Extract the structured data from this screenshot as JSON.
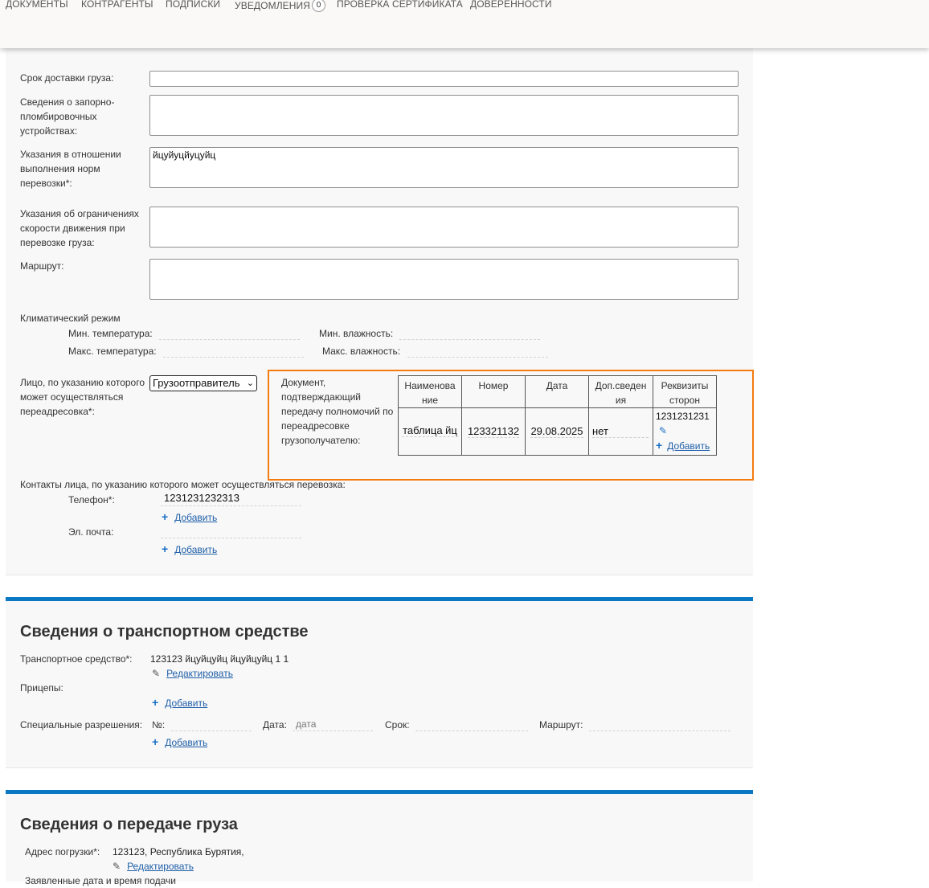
{
  "nav": {
    "items": [
      "ДОКУМЕНТЫ",
      "КОНТРАГЕНТЫ",
      "ПОДПИСКИ",
      "УВЕДОМЛЕНИЯ",
      "ПРОВЕРКА СЕРТИФИКАТА",
      "ДОВЕРЕННОСТИ"
    ],
    "notifications_count": "0"
  },
  "form": {
    "delivery_term_label": "Срок доставки груза:",
    "seal_devices_label": "Сведения о запорно-пломбировочных устройствах:",
    "norms_label": "Указания в отношении выполнения норм перевозки*:",
    "norms_value": "йцуйуцйуцуйц",
    "speed_limits_label": "Указания об ограничениях скорости движения при перевозке груза:",
    "route_label": "Маршрут:",
    "climate": {
      "title": "Климатический режим",
      "min_temp_label": "Мин. температура:",
      "max_temp_label": "Макс. температура:",
      "min_humidity_label": "Мин. влажность:",
      "max_humidity_label": "Макс. влажность:"
    },
    "redirect_person_label": "Лицо, по указанию которого может осуществляться переадресовка*:",
    "redirect_person_value": "Грузоотправитель",
    "authority_doc_label": "Документ, подтверждающий передачу полномочий по переадресовке грузополучателю:",
    "authority_table": {
      "headers": [
        "Наименова ние",
        "Номер",
        "Дата",
        "Доп.сведен ия",
        "Реквизиты сторон"
      ],
      "row": {
        "name": "таблица йц",
        "number": "123321132",
        "date": "29.08.2025",
        "extra": "нет",
        "requisites": "1231231231",
        "add_label": "Добавить"
      }
    },
    "contacts": {
      "title": "Контакты лица, по указанию которого может осуществляться перевозка:",
      "phone_label": "Телефон*:",
      "phone_value": "1231231232313",
      "email_label": "Эл. почта:",
      "add_label": "Добавить"
    }
  },
  "vehicle": {
    "title": "Сведения о транспортном средстве",
    "vehicle_label": "Транспортное средство*:",
    "vehicle_value": "123123 йцуйцуйц йцуйцуйц 1 1",
    "edit_label": "Редактировать",
    "trailers_label": "Прицепы:",
    "add_label": "Добавить",
    "permits_label": "Специальные разрешения:",
    "permit_no_label": "№:",
    "permit_date_label": "Дата:",
    "permit_date_placeholder": "дата",
    "permit_term_label": "Срок:",
    "permit_route_label": "Маршрут:"
  },
  "cargo_transfer": {
    "title": "Сведения о передаче груза",
    "load_address_label": "Адрес погрузки*:",
    "load_address_value": "123123, Республика Бурятия,",
    "edit_label": "Редактировать",
    "declared_datetime_label": "Заявленные дата и время подачи"
  }
}
